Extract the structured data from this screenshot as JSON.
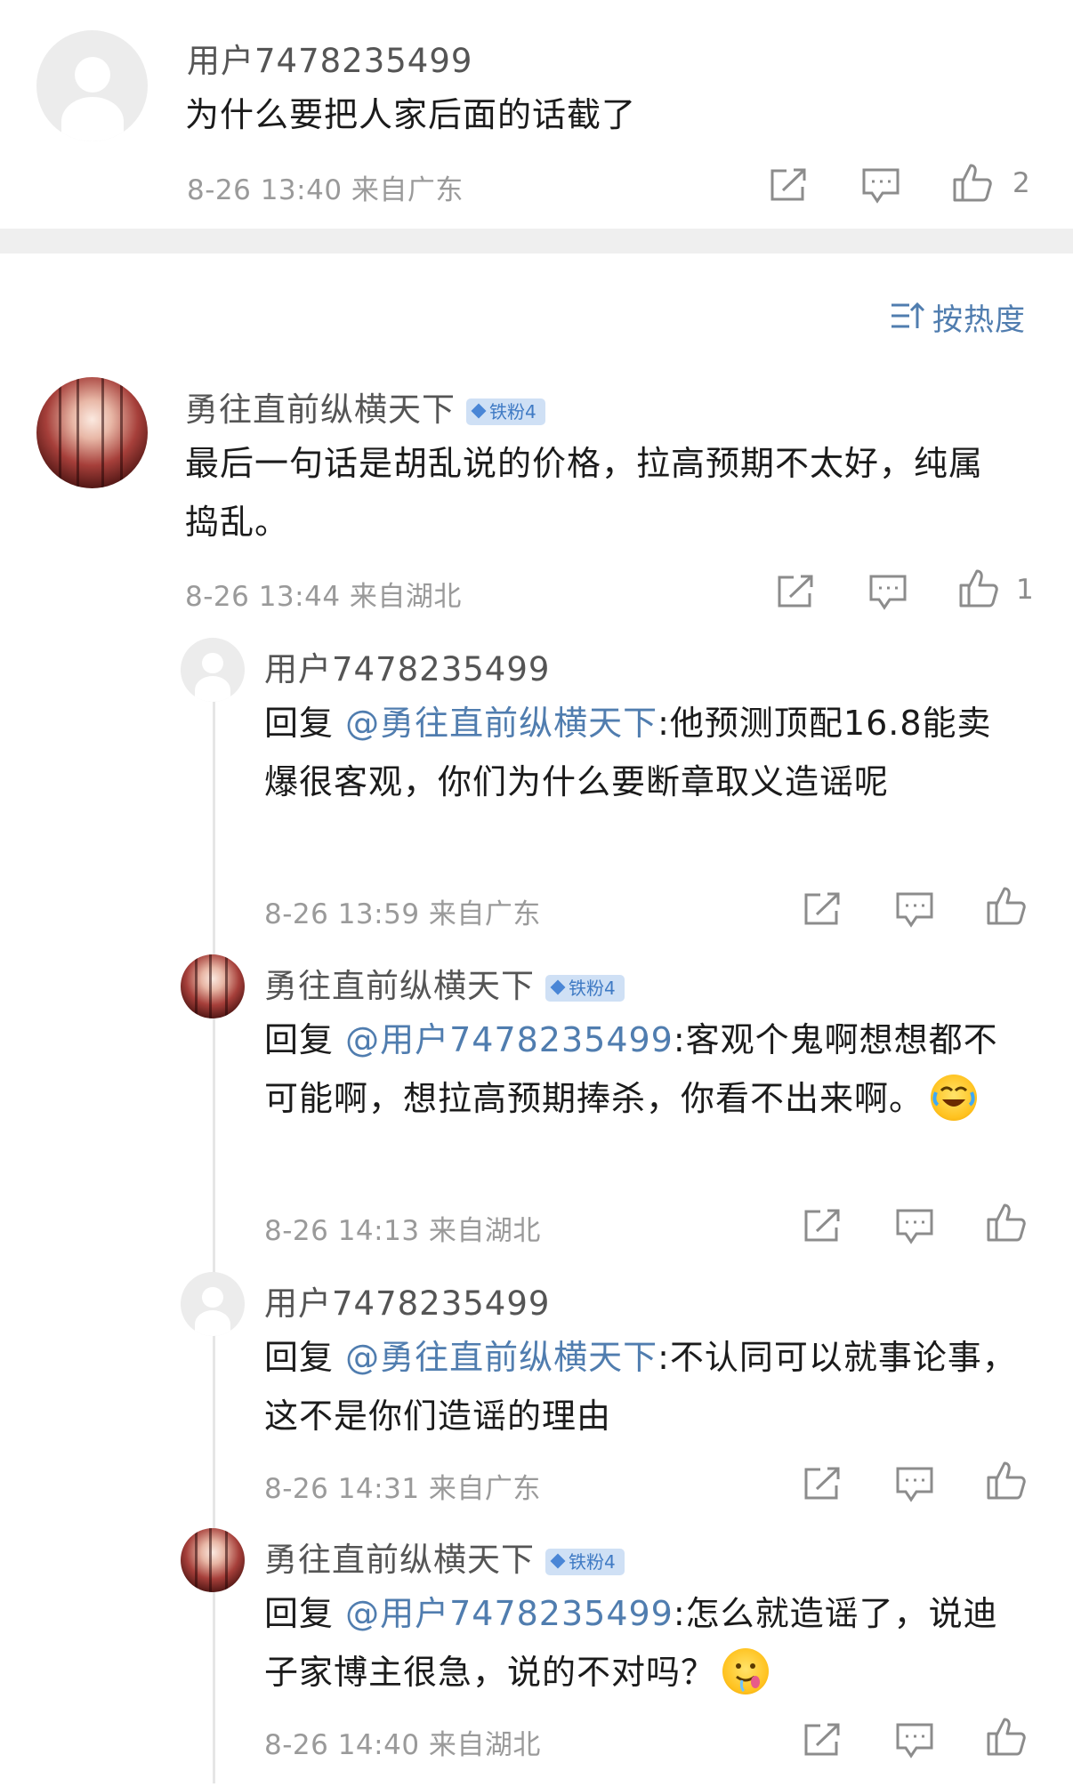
{
  "top_comment": {
    "user": "用户7478235499",
    "text": "为什么要把人家后面的话截了",
    "meta": "8-26 13:40  来自广东",
    "likes": "2"
  },
  "sort": {
    "label": "按热度",
    "icon": "sort-icon"
  },
  "main_comment": {
    "user": "勇往直前纵横天下",
    "badge": "铁粉4",
    "text": "最后一句话是胡乱说的价格，拉高预期不太好，纯属捣乱。",
    "meta": "8-26 13:44  来自湖北",
    "likes": "1"
  },
  "replies": [
    {
      "user": "用户7478235499",
      "reply_prefix": "回复 ",
      "mention": "@勇往直前纵横天下",
      "text": ":他预测顶配16.8能卖爆很客观，你们为什么要断章取义造谣呢",
      "meta": "8-26 13:59  来自广东"
    },
    {
      "user": "勇往直前纵横天下",
      "badge": "铁粉4",
      "reply_prefix": "回复 ",
      "mention": "@用户7478235499",
      "text": ":客观个鬼啊想想都不可能啊，想拉高预期捧杀，你看不出来啊。",
      "emoji": "laughing-tears-emoji",
      "meta": "8-26 14:13  来自湖北"
    },
    {
      "user": "用户7478235499",
      "reply_prefix": "回复 ",
      "mention": "@勇往直前纵横天下",
      "text": ":不认同可以就事论事，这不是你们造谣的理由",
      "meta": "8-26 14:31  来自广东"
    },
    {
      "user": "勇往直前纵横天下",
      "badge": "铁粉4",
      "reply_prefix": "回复 ",
      "mention": "@用户7478235499",
      "text": ":怎么就造谣了，说迪子家博主很急，说的不对吗？",
      "emoji": "drooling-face-emoji",
      "meta": "8-26 14:40  来自湖北"
    }
  ],
  "colors": {
    "link": "#507daf",
    "badge_bg": "#cfe0f5",
    "divider": "#efefef",
    "meta": "#9a9a9a"
  }
}
